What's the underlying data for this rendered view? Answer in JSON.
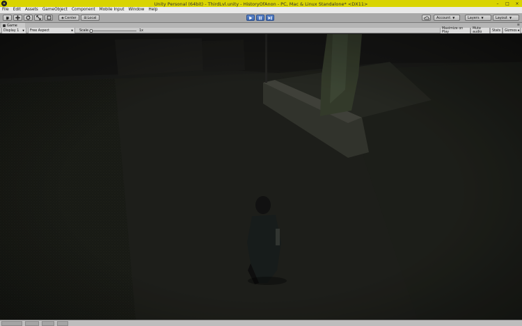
{
  "window": {
    "title": "Unity Personal (64bit) - ThirdLvl.unity - HistoryOfAnon - PC, Mac & Linux Standalone* <DX11>",
    "controls": [
      "–",
      "□",
      "×"
    ]
  },
  "menu": {
    "items": [
      "File",
      "Edit",
      "Assets",
      "GameObject",
      "Component",
      "Mobile Input",
      "Window",
      "Help"
    ]
  },
  "toolbar": {
    "tools": [
      "hand-icon",
      "move-icon",
      "rotate-icon",
      "scale-icon",
      "rect-icon"
    ],
    "pivot_label": "Center",
    "space_label": "Local",
    "play": "play-icon",
    "pause": "pause-icon",
    "step": "step-icon",
    "cloud": "cloud-icon",
    "account_label": "Account",
    "layers_label": "Layers",
    "layout_label": "Layout"
  },
  "tab": {
    "label": "Game"
  },
  "gamebar": {
    "display_label": "Display 1",
    "aspect_label": "Free Aspect",
    "scale_label": "Scale",
    "scale_value": "1x",
    "scale_fraction": 0.02,
    "maximize_label": "Maximize on Play",
    "mute_label": "Mute audio",
    "stats_label": "Stats",
    "gizmos_label": "Gizmos"
  },
  "colors": {
    "play_mode_tint": "#d9d400",
    "active_button": "#4a74bd"
  }
}
